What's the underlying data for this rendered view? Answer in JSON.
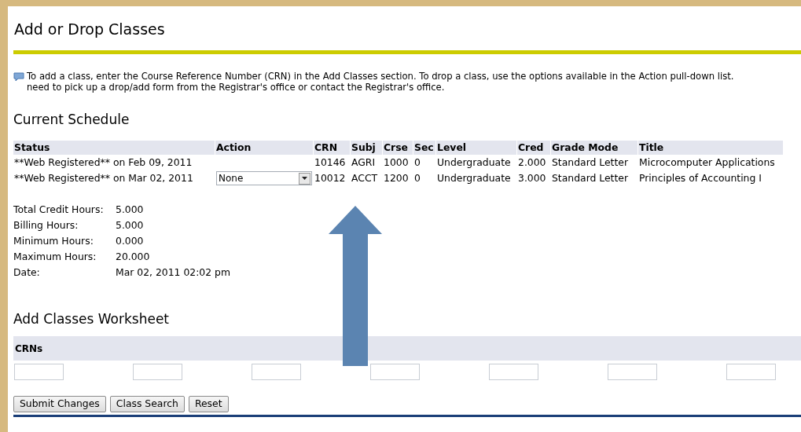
{
  "page_title": "Add or Drop Classes",
  "info_lines": [
    "To add a class, enter the Course Reference Number (CRN) in the Add Classes section. To drop a class, use the options available in the Action pull-down list.",
    "need to pick up a drop/add form from the Registrar's office or contact the Registrar's office."
  ],
  "current_schedule": {
    "heading": "Current Schedule",
    "columns": [
      "Status",
      "Action",
      "CRN",
      "Subj",
      "Crse",
      "Sec",
      "Level",
      "Cred",
      "Grade Mode",
      "Title"
    ],
    "rows": [
      {
        "status": "**Web Registered** on Feb 09, 2011",
        "crn": "10146",
        "subj": "AGRI",
        "crse": "1000",
        "sec": "0",
        "level": "Undergraduate",
        "cred": "2.000",
        "grade_mode": "Standard Letter",
        "title": "Microcomputer Applications"
      },
      {
        "status": "**Web Registered** on Mar 02, 2011",
        "action": "None",
        "crn": "10012",
        "subj": "ACCT",
        "crse": "1200",
        "sec": "0",
        "level": "Undergraduate",
        "cred": "3.000",
        "grade_mode": "Standard Letter",
        "title": "Principles of Accounting I"
      }
    ],
    "totals": [
      {
        "label": "Total Credit Hours:",
        "value": "5.000"
      },
      {
        "label": "Billing Hours:",
        "value": "5.000"
      },
      {
        "label": "Minimum Hours:",
        "value": "0.000"
      },
      {
        "label": "Maximum Hours:",
        "value": "20.000"
      },
      {
        "label": "Date:",
        "value": "Mar 02, 2011 02:02 pm"
      }
    ]
  },
  "worksheet": {
    "heading": "Add Classes Worksheet",
    "band_label": "CRNs",
    "crn_fields": [
      {
        "disabled": false
      },
      {
        "disabled": false
      },
      {
        "disabled": false
      },
      {
        "disabled": false
      },
      {
        "disabled": false
      },
      {
        "disabled": false
      },
      {
        "disabled": false
      }
    ]
  },
  "buttons": [
    "Submit Changes",
    "Class Search",
    "Reset"
  ]
}
